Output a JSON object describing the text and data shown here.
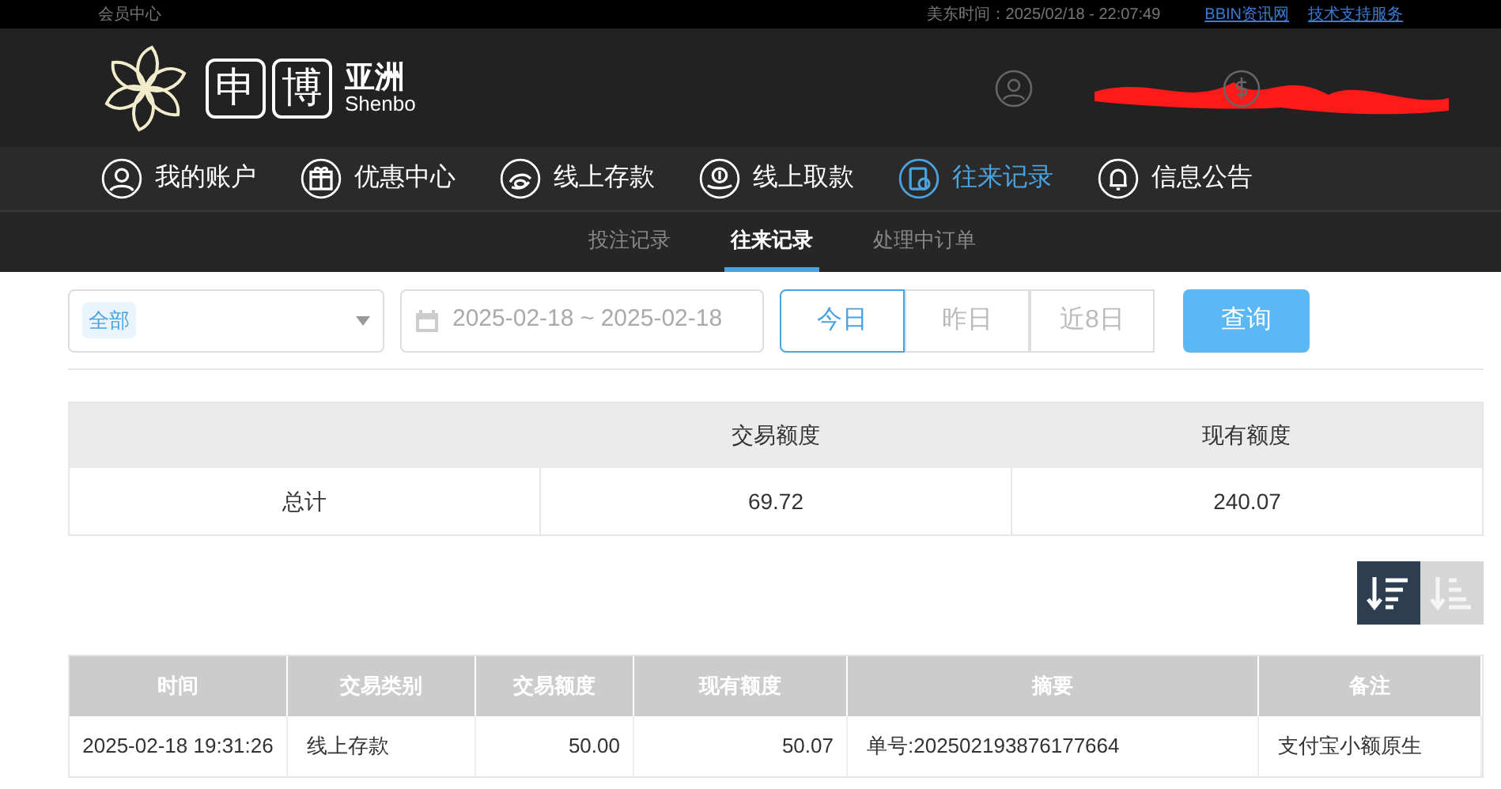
{
  "top_bar": {
    "left_link": "会员中心",
    "time": "美东时间：2025/02/18 - 22:07:49",
    "links": [
      "BBIN资讯网",
      "技术支持服务"
    ]
  },
  "logo": {
    "chars": [
      "申",
      "博"
    ],
    "name": "亚洲",
    "sub": "Shenbo"
  },
  "main_nav": [
    {
      "label": "我的账户",
      "kind": "user",
      "selected": false
    },
    {
      "label": "优惠中心",
      "kind": "gift",
      "selected": false
    },
    {
      "label": "线上存款",
      "kind": "deposit",
      "selected": false
    },
    {
      "label": "线上取款",
      "kind": "withdraw",
      "selected": false
    },
    {
      "label": "往来记录",
      "kind": "records",
      "selected": true
    },
    {
      "label": "信息公告",
      "kind": "bell",
      "selected": false
    }
  ],
  "sub_nav": [
    {
      "label": "投注记录",
      "selected": false
    },
    {
      "label": "往来记录",
      "selected": true
    },
    {
      "label": "处理中订单",
      "selected": false
    }
  ],
  "filters": {
    "type_tag": "全部",
    "date_range": "2025-02-18 ~ 2025-02-18",
    "quick_ranges": [
      {
        "label": "今日",
        "selected": true
      },
      {
        "label": "昨日",
        "selected": false
      },
      {
        "label": "近8日",
        "selected": false
      }
    ],
    "search_button": "查询"
  },
  "summary": {
    "columns": [
      "",
      "交易额度",
      "现有额度"
    ],
    "row": [
      "总计",
      "69.72",
      "240.07"
    ]
  },
  "sort_buttons": [
    {
      "kind": "desc",
      "selected": true
    },
    {
      "kind": "asc",
      "selected": false
    }
  ],
  "table": {
    "columns": [
      "时间",
      "交易类别",
      "交易额度",
      "现有额度",
      "摘要",
      "备注"
    ],
    "rows": [
      [
        "2025-02-18 19:31:26",
        "线上存款",
        "50.00",
        "50.07",
        "单号:202502193876177664",
        "支付宝小额原生"
      ]
    ]
  }
}
